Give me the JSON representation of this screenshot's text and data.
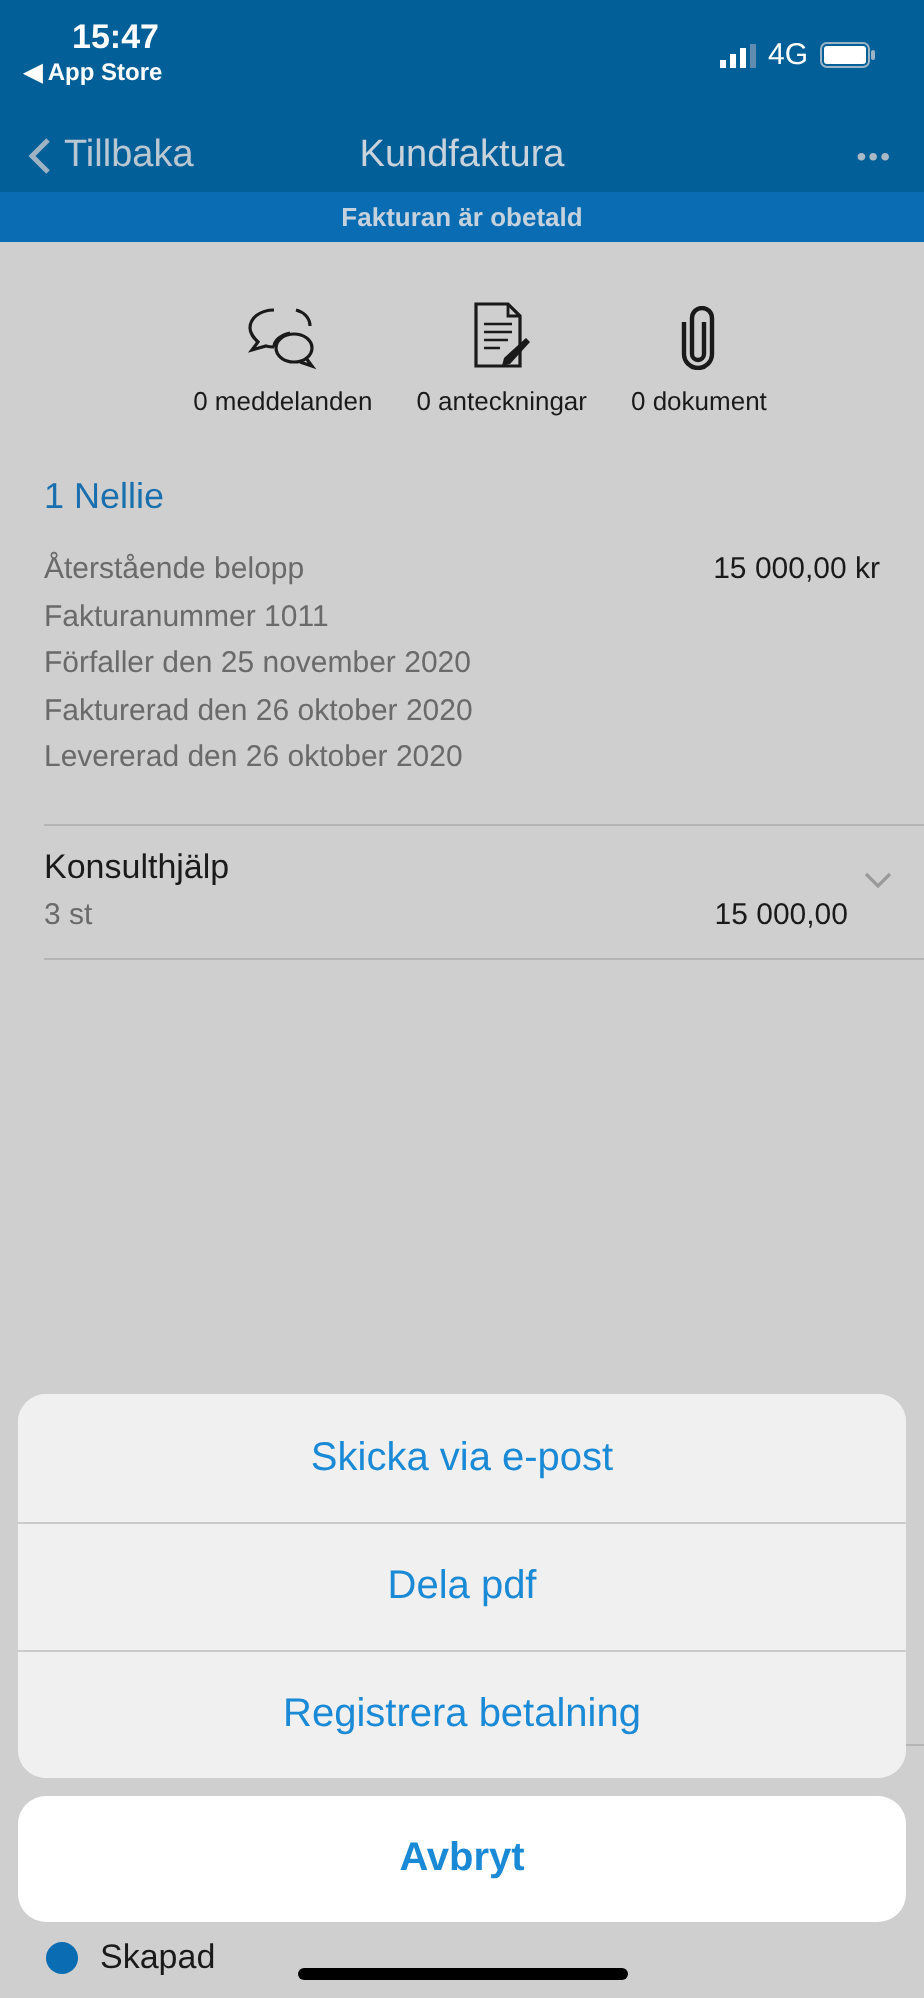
{
  "status_bar": {
    "time": "15:47",
    "back_app": "◀ App Store",
    "network": "4G"
  },
  "nav": {
    "back": "Tillbaka",
    "title": "Kundfaktura",
    "more": "•••"
  },
  "banner": "Fakturan är obetald",
  "counters": [
    {
      "kind": "messages",
      "label": "0 meddelanden"
    },
    {
      "kind": "notes",
      "label": "0 anteckningar"
    },
    {
      "kind": "documents",
      "label": "0 dokument"
    }
  ],
  "customer": "1 Nellie",
  "details": [
    {
      "label": "Återstående belopp",
      "value": "15 000,00 kr"
    },
    {
      "label": "Fakturanummer 1011"
    },
    {
      "label": "Förfaller den 25 november 2020"
    },
    {
      "label": "Fakturerad den 26 oktober 2020"
    },
    {
      "label": "Levererad den 26 oktober 2020"
    }
  ],
  "line_items": [
    {
      "name": "Konsulthjälp",
      "quantity": "3 st",
      "amount": "15 000,00",
      "expanded": false
    }
  ],
  "history": [
    {
      "label": "Skapad",
      "color": "#0a6db3"
    }
  ],
  "action_sheet": {
    "actions": [
      "Skicka via e-post",
      "Dela pdf",
      "Registrera betalning"
    ],
    "cancel": "Avbryt"
  }
}
